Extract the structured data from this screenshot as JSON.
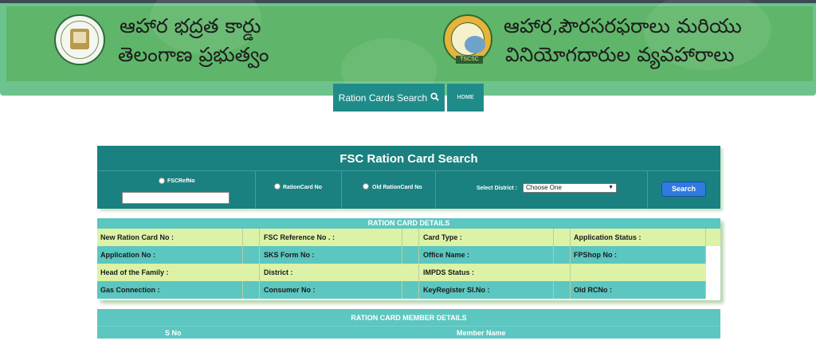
{
  "header": {
    "title_left_line1": "ఆహార భద్రత కార్డు",
    "title_left_line2": "తెలంగాణ ప్రభుత్వం",
    "title_right_line1": "ఆహార,పౌరసరఫరాలు మరియు",
    "title_right_line2": "వినియోగదారుల వ్యవహారాలు",
    "right_logo_tag": "TSCSC",
    "banner_color": "#5fb66a"
  },
  "nav": {
    "search_label": "Ration Cards Search",
    "search_icon": "search-icon",
    "home_label": "HOME"
  },
  "search": {
    "title": "FSC Ration Card Search",
    "opt_fscref": "FSCRefNo",
    "opt_rationcard": "RationCard No",
    "opt_old_rationcard": "Old RationCard No",
    "district_label": "Select District :",
    "district_selected": "Choose One",
    "search_button": "Search"
  },
  "details": {
    "title": "RATION CARD DETAILS",
    "rows": [
      [
        "New Ration Card No :",
        "FSC Reference No . :",
        "Card Type :",
        "Application Status :"
      ],
      [
        "Application No :",
        "SKS Form No :",
        "Office Name :",
        "FPShop No :"
      ],
      [
        "Head of the Family :",
        "District :",
        "IMPDS Status :",
        ""
      ],
      [
        "Gas Connection :",
        "Consumer No :",
        "KeyRegister Sl.No :",
        "Old RCNo :"
      ]
    ]
  },
  "members": {
    "title": "RATION CARD MEMBER DETAILS",
    "col_sno": "S No",
    "col_name": "Member Name"
  },
  "colors": {
    "teal_dark": "#1a8180",
    "teal_light": "#5cc6c0",
    "row_light": "#dcf2a6",
    "button_blue": "#2f7be0"
  }
}
